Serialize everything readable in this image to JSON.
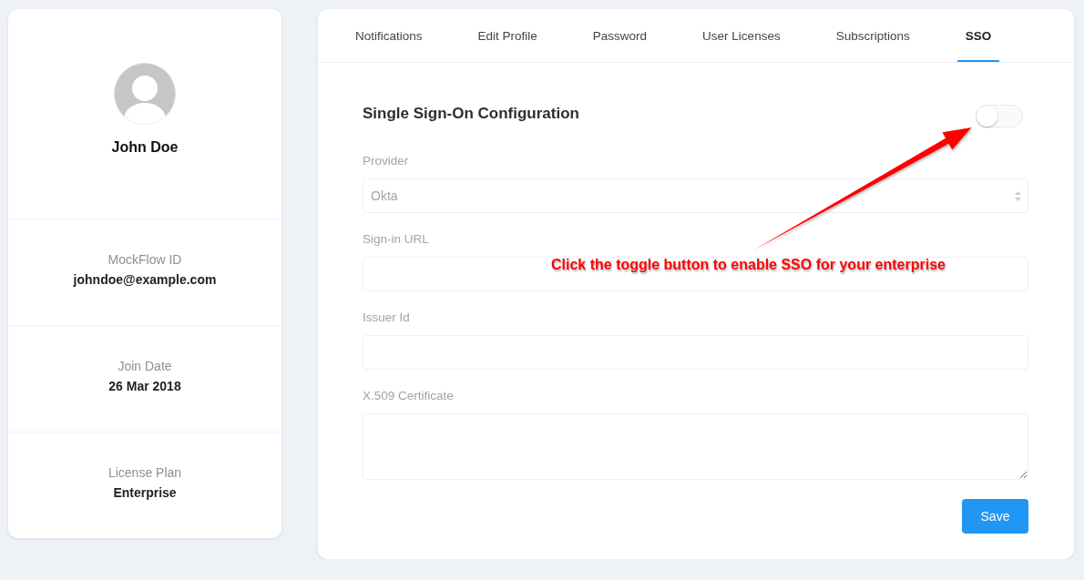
{
  "profile": {
    "name": "John Doe",
    "details": [
      {
        "label": "MockFlow ID",
        "value": "johndoe@example.com"
      },
      {
        "label": "Join Date",
        "value": "26 Mar 2018"
      },
      {
        "label": "License Plan",
        "value": "Enterprise"
      }
    ]
  },
  "tabs": [
    {
      "label": "Notifications",
      "selected": false
    },
    {
      "label": "Edit Profile",
      "selected": false
    },
    {
      "label": "Password",
      "selected": false
    },
    {
      "label": "User Licenses",
      "selected": false
    },
    {
      "label": "Subscriptions",
      "selected": false
    },
    {
      "label": "SSO",
      "selected": true
    }
  ],
  "sso": {
    "title": "Single Sign-On Configuration",
    "toggle": {
      "on": false
    },
    "fields": [
      {
        "kind": "select",
        "label": "Provider",
        "value": "Okta",
        "disabled": true
      },
      {
        "kind": "text",
        "label": "Sign-in URL",
        "disabled": true
      },
      {
        "kind": "text",
        "label": "Issuer Id",
        "disabled": true
      },
      {
        "kind": "textarea",
        "label": "X.509 Certificate",
        "disabled": true
      }
    ],
    "save_button": "Save"
  },
  "annotation": {
    "text": "Click the toggle button to enable SSO for your enterprise"
  }
}
